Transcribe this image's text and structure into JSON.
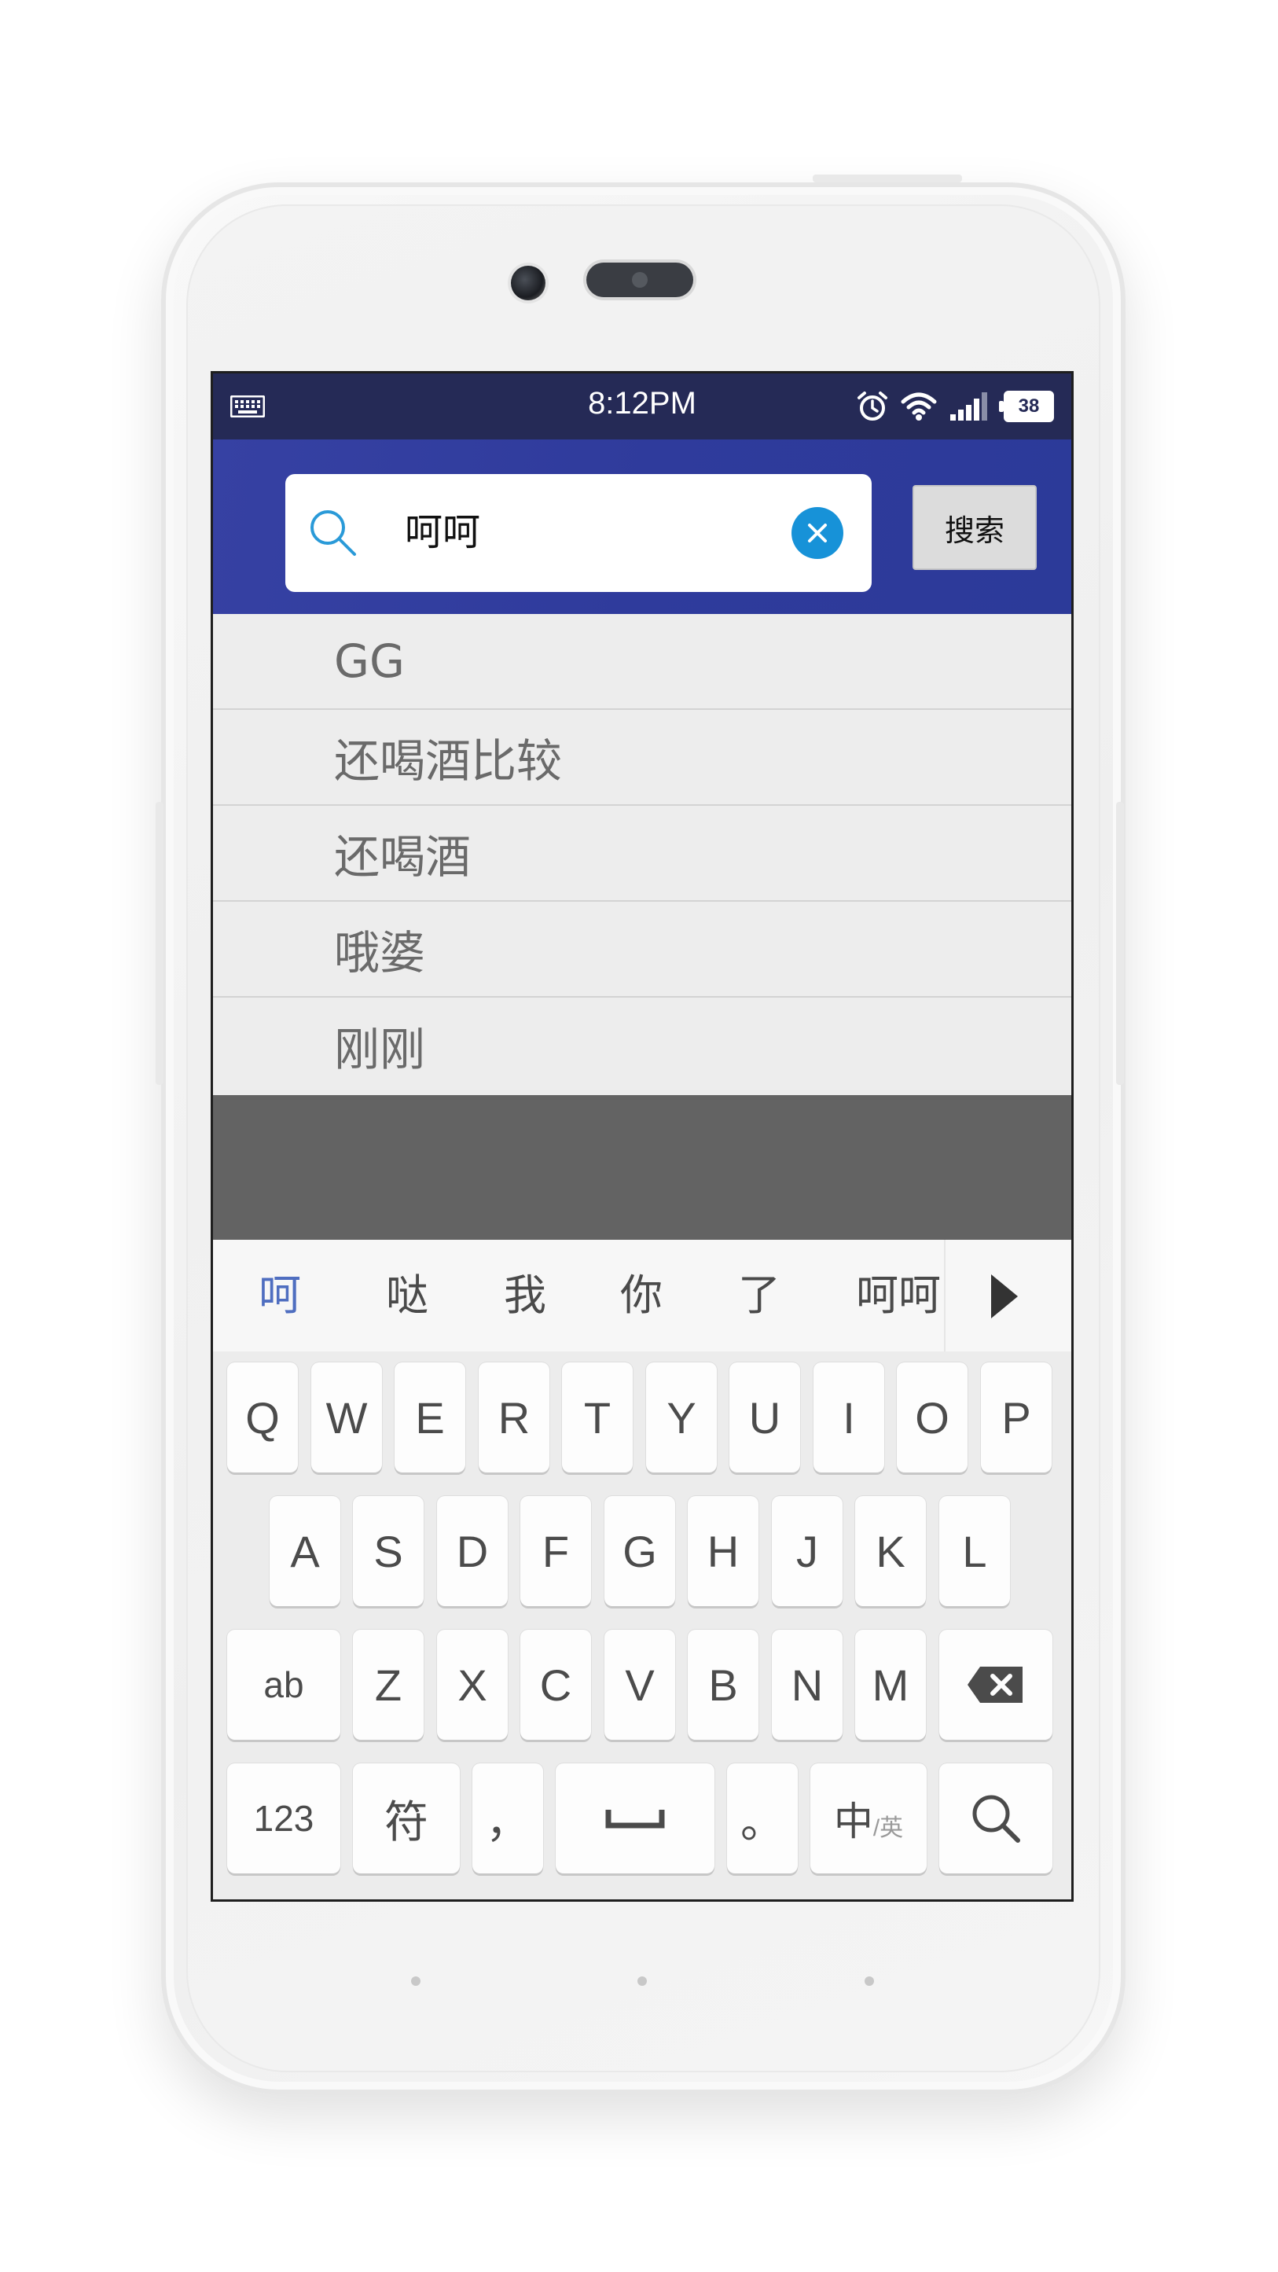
{
  "status_bar": {
    "time": "8:12PM",
    "battery_level": "38",
    "icons": [
      "keyboard-icon",
      "alarm-icon",
      "wifi-icon",
      "signal-icon",
      "battery-icon"
    ]
  },
  "search": {
    "query": "呵呵",
    "button_label": "搜索",
    "accent_color": "#2f3b9c",
    "clear_color": "#1792d8"
  },
  "suggestions": [
    {
      "text": "GG"
    },
    {
      "text": "还喝酒比较"
    },
    {
      "text": "还喝酒"
    },
    {
      "text": "哦婆"
    },
    {
      "text": "刚刚"
    }
  ],
  "candidates": [
    "呵",
    "哒",
    "我",
    "你",
    "了",
    "呵呵"
  ],
  "keyboard": {
    "row1": [
      "Q",
      "W",
      "E",
      "R",
      "T",
      "Y",
      "U",
      "I",
      "O",
      "P"
    ],
    "row2": [
      "A",
      "S",
      "D",
      "F",
      "G",
      "H",
      "J",
      "K",
      "L"
    ],
    "row3": {
      "shift": "ab",
      "letters": [
        "Z",
        "X",
        "C",
        "V",
        "B",
        "N",
        "M"
      ]
    },
    "row4": {
      "num": "123",
      "symbols": "符",
      "comma": "，",
      "period": "。",
      "lang_main": "中",
      "lang_sub": "/英"
    }
  }
}
